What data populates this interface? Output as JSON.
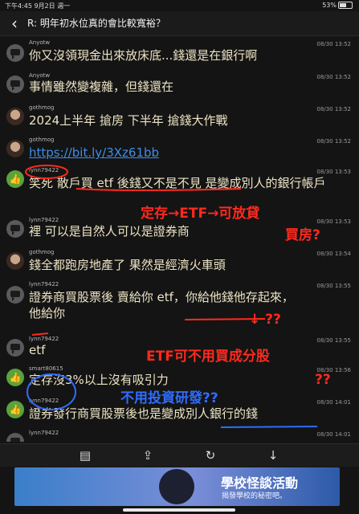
{
  "status": {
    "time_date": "下午4:45  9月2日 週一",
    "battery": "53%"
  },
  "header": {
    "title": "R: 明年初水位真的會比較寬裕？"
  },
  "messages": [
    {
      "user": "Anyotw",
      "time": "08/30 13:52",
      "text": "你又沒領現金出來放床底...錢還是在銀行啊"
    },
    {
      "user": "Anyotw",
      "time": "08/30 13:52",
      "text": "事情雖然變複雜，但錢還在"
    },
    {
      "user": "gothmog",
      "time": "08/30 13:52",
      "text": "2024上半年 搶房 下半年 搶錢大作戰"
    },
    {
      "user": "gothmog",
      "time": "08/30 13:52",
      "text": "https://bit.ly/3Xz61bb"
    },
    {
      "user": "lynn79422",
      "time": "08/30 13:53",
      "text": "笑死 散戶買 etf 後錢又不是不見 是變成別人的銀行帳戶"
    },
    {
      "user": "lynn79422",
      "time": "08/30 13:53",
      "text": "裡 可以是自然人可以是證券商"
    },
    {
      "user": "gothmog",
      "time": "08/30 13:54",
      "text": "錢全都跑房地產了 果然是經濟火車頭"
    },
    {
      "user": "lynn79422",
      "time": "08/30 13:55",
      "text": "證券商買股票後 賣給你 etf，你給他錢他存起來，他給你"
    },
    {
      "user": "lynn79422",
      "time": "08/30 13:55",
      "text": "etf"
    },
    {
      "user": "smart80615",
      "time": "08/30 13:56",
      "text": "定存沒3%以上沒有吸引力"
    },
    {
      "user": "lynn79422",
      "time": "08/30 14:01",
      "text": "證券發行商買股票後也是變成別人銀行的錢"
    },
    {
      "user": "lynn79422",
      "time": "08/30 14:01",
      "text": ""
    }
  ],
  "annotations": {
    "a1": "定存→ETF→可放貸",
    "a2": "買房?",
    "a3": "↓ ??",
    "a4": "ETF可不用買成分股",
    "a5": "??",
    "a6": "不用投資研發??"
  },
  "ad": {
    "title": "學校怪談活動",
    "subtitle": "揭發學校的秘密吧。"
  }
}
